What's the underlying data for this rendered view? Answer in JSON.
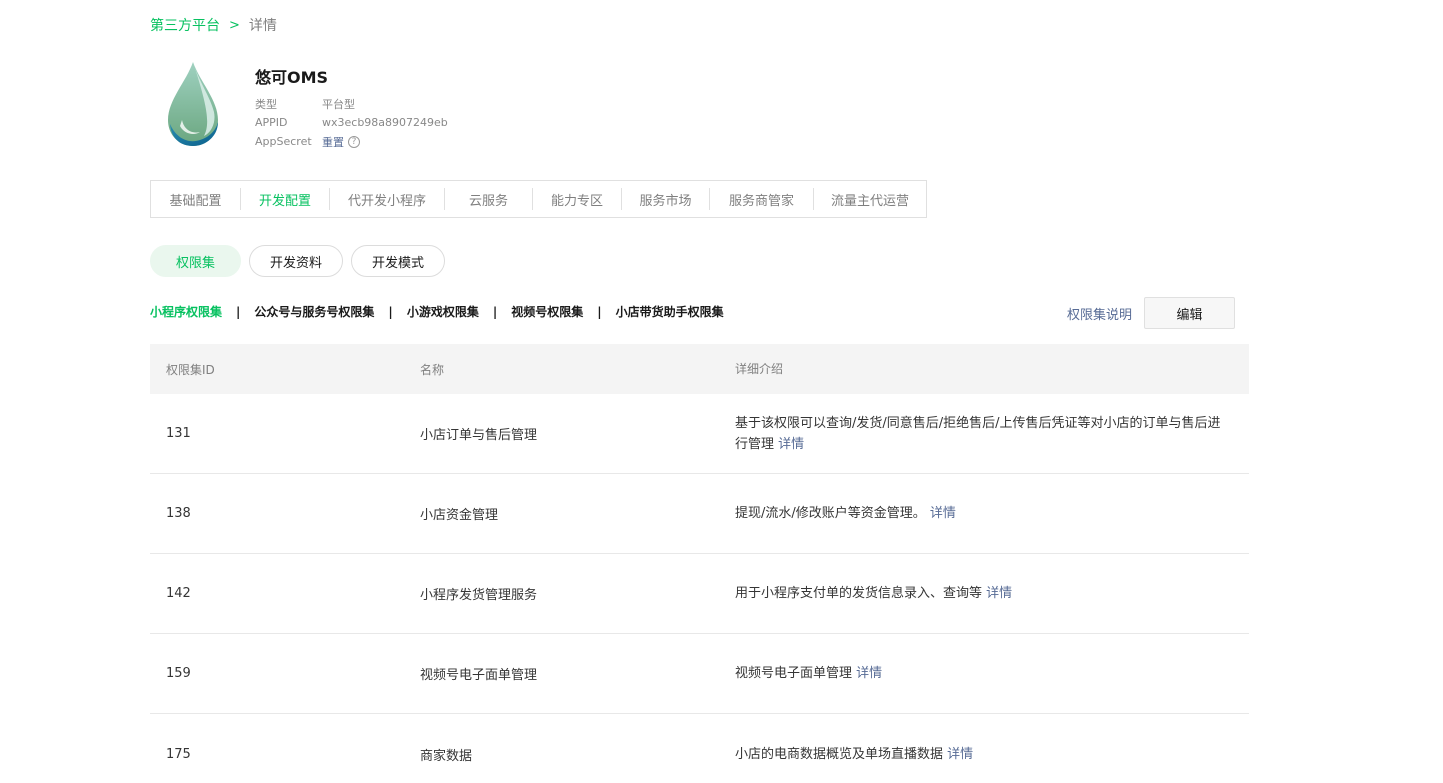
{
  "breadcrumb": {
    "parent": "第三方平台",
    "separator": ">",
    "current": "详情"
  },
  "app": {
    "name": "悠可OMS",
    "meta": [
      {
        "key": "类型",
        "value": "平台型"
      },
      {
        "key": "APPID",
        "value": "wx3ecb98a8907249eb"
      },
      {
        "key": "AppSecret",
        "value": "重置"
      }
    ],
    "help_glyph": "?"
  },
  "main_tabs": [
    {
      "label": "基础配置",
      "active": false
    },
    {
      "label": "开发配置",
      "active": true
    },
    {
      "label": "代开发小程序",
      "active": false
    },
    {
      "label": "云服务",
      "active": false
    },
    {
      "label": "能力专区",
      "active": false
    },
    {
      "label": "服务市场",
      "active": false
    },
    {
      "label": "服务商管家",
      "active": false
    },
    {
      "label": "流量主代运营",
      "active": false
    }
  ],
  "pill_tabs": [
    {
      "label": "权限集",
      "active": true
    },
    {
      "label": "开发资料",
      "active": false
    },
    {
      "label": "开发模式",
      "active": false
    }
  ],
  "sub_tabs": [
    {
      "label": "小程序权限集",
      "active": true
    },
    {
      "label": "公众号与服务号权限集",
      "active": false
    },
    {
      "label": "小游戏权限集",
      "active": false
    },
    {
      "label": "视频号权限集",
      "active": false
    },
    {
      "label": "小店带货助手权限集",
      "active": false
    }
  ],
  "sub_sep": "|",
  "actions": {
    "help_link": "权限集说明",
    "edit": "编辑"
  },
  "table": {
    "headers": [
      "权限集ID",
      "名称",
      "详细介绍"
    ],
    "link_label": "详情",
    "rows": [
      {
        "id": "131",
        "name": "小店订单与售后管理",
        "desc": "基于该权限可以查询/发货/同意售后/拒绝售后/上传售后凭证等对小店的订单与售后进行管理"
      },
      {
        "id": "138",
        "name": "小店资金管理",
        "desc": "提现/流水/修改账户等资金管理。"
      },
      {
        "id": "142",
        "name": "小程序发货管理服务",
        "desc": "用于小程序支付单的发货信息录入、查询等"
      },
      {
        "id": "159",
        "name": "视频号电子面单管理",
        "desc": "视频号电子面单管理"
      },
      {
        "id": "175",
        "name": "商家数据",
        "desc": "小店的电商数据概览及单场直播数据"
      }
    ]
  },
  "colors": {
    "accent": "#07c160",
    "link": "#576b95"
  }
}
